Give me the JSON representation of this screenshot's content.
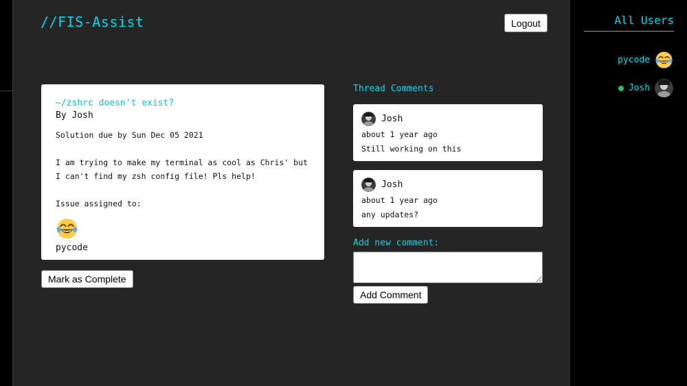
{
  "app": {
    "title": "//FIS-Assist"
  },
  "header": {
    "logout_label": "Logout"
  },
  "issue": {
    "title": "~/zshrc doesn't exist?",
    "author": "By Josh",
    "due": "Solution due by Sun Dec 05 2021",
    "description": "I am trying to make my terminal as cool as Chris' but I can't find my zsh config file! Pls help!",
    "assigned_label": "Issue assigned to:",
    "assignee": {
      "name": "pycode",
      "icon": "tears-of-joy-emoji-icon"
    },
    "complete_label": "Mark as Complete"
  },
  "thread": {
    "heading": "Thread Comments",
    "comments": [
      {
        "user": "Josh",
        "time": "about 1 year ago",
        "text": "Still working on this"
      },
      {
        "user": "Josh",
        "time": "about 1 year ago",
        "text": "any updates?"
      }
    ],
    "add_label": "Add new comment:",
    "add_button": "Add Comment"
  },
  "sidebar": {
    "title": "All Users",
    "users": [
      {
        "name": "pycode",
        "online": false,
        "icon": "tears-of-joy-emoji-icon"
      },
      {
        "name": "Josh",
        "online": true,
        "icon": "avatar-photo"
      }
    ]
  },
  "colors": {
    "accent": "#00d8e8",
    "online": "#22c55e",
    "panel": "#252525",
    "background": "#000000"
  }
}
